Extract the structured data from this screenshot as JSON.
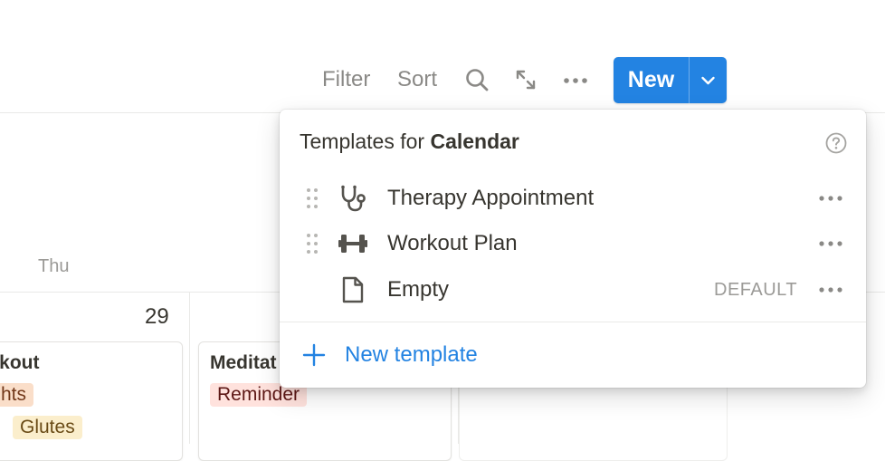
{
  "toolbar": {
    "filter_label": "Filter",
    "sort_label": "Sort",
    "search_icon": "search-icon",
    "expand_icon": "expand-arrows-icon",
    "more_icon": "more-horizontal-icon",
    "new_label": "New",
    "new_dropdown_icon": "chevron-down-icon",
    "accent_color": "#2383e2"
  },
  "calendar": {
    "day_header": "Thu",
    "date_number": "29",
    "events": [
      {
        "title": "rkout",
        "tags": [
          {
            "label": "hts",
            "bg": "#fadec9",
            "fg": "#73391b"
          },
          {
            "label": "Glutes",
            "bg": "#fbeecc",
            "fg": "#6a4b16"
          }
        ]
      },
      {
        "title": "Meditat",
        "tags": [
          {
            "label": "Reminder",
            "bg": "#ffe2dd",
            "fg": "#5d1715"
          }
        ]
      }
    ]
  },
  "templates_popup": {
    "header_prefix": "Templates for ",
    "header_db": "Calendar",
    "help_icon": "question-circle-icon",
    "items": [
      {
        "label": "Therapy Appointment",
        "icon": "stethoscope-icon",
        "default_badge": ""
      },
      {
        "label": "Workout Plan",
        "icon": "dumbbell-icon",
        "default_badge": ""
      },
      {
        "label": "Empty",
        "icon": "page-icon",
        "default_badge": "DEFAULT"
      }
    ],
    "new_template_label": "New template"
  }
}
